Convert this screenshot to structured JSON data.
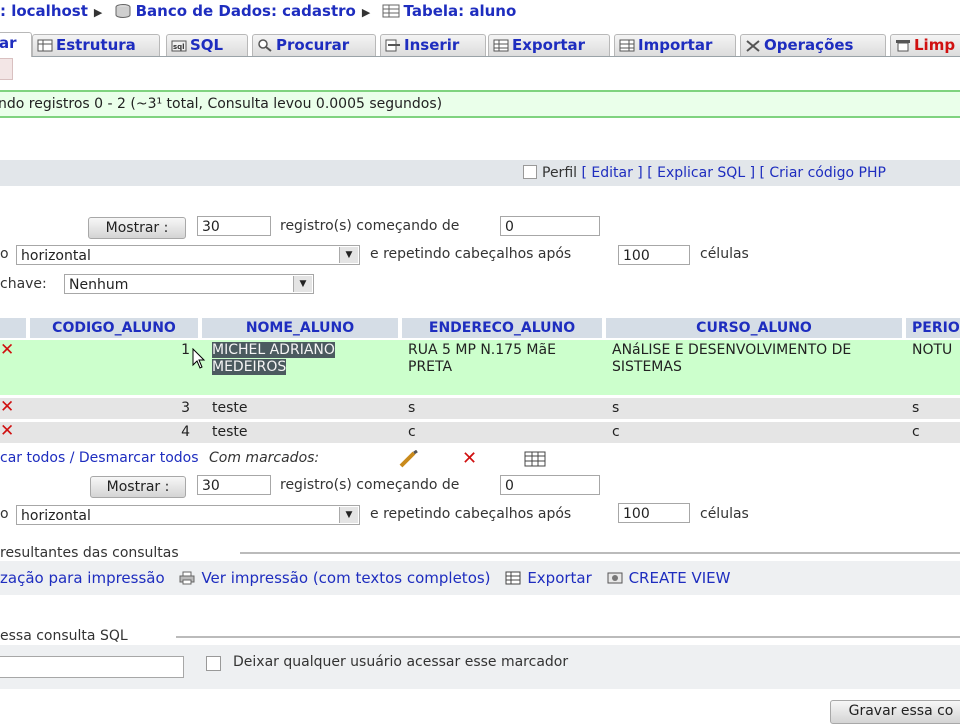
{
  "breadcrumb": {
    "server": ": localhost",
    "database": "Banco de Dados: cadastro",
    "table": "Tabela: aluno"
  },
  "tabs": [
    {
      "label": "ar",
      "icon": "browse-icon"
    },
    {
      "label": "Estrutura",
      "icon": "structure-icon"
    },
    {
      "label": "SQL",
      "icon": "sql-icon"
    },
    {
      "label": "Procurar",
      "icon": "search-icon"
    },
    {
      "label": "Inserir",
      "icon": "insert-icon"
    },
    {
      "label": "Exportar",
      "icon": "export-icon"
    },
    {
      "label": "Importar",
      "icon": "import-icon"
    },
    {
      "label": "Operações",
      "icon": "operations-icon"
    },
    {
      "label": "Limp",
      "icon": "empty-icon"
    }
  ],
  "notice": "ndo registros 0 - 2 (~3¹ total, Consulta levou 0.0005 segundos)",
  "profile_bar": {
    "profile": "Perfil",
    "edit": "[ Editar ]",
    "explain": "[ Explicar SQL ]",
    "php": "[ Criar código PHP"
  },
  "nav_top": {
    "show_button": "Mostrar :",
    "rows": "30",
    "start_label": "registro(s) começando de",
    "start": "0",
    "mode_prefix": "o",
    "mode": "horizontal",
    "repeat_label": "e repetindo cabeçalhos após",
    "repeat": "100",
    "cells_label": "células",
    "key_label": "chave:",
    "key_value": "Nenhum"
  },
  "table": {
    "columns": [
      "CODIGO_ALUNO",
      "NOME_ALUNO",
      "ENDERECO_ALUNO",
      "CURSO_ALUNO",
      "PERIO"
    ],
    "rows": [
      {
        "codigo": "1",
        "nome": "MICHEL ADRIANO MEDEIROS",
        "endereco": "RUA 5 MP N.175 MãE PRETA",
        "curso": "ANáLISE E DESENVOLVIMENTO DE SISTEMAS",
        "periodo": "NOTU"
      },
      {
        "codigo": "3",
        "nome": "teste",
        "endereco": "s",
        "curso": "s",
        "periodo": "s"
      },
      {
        "codigo": "4",
        "nome": "teste",
        "endereco": "c",
        "curso": "c",
        "periodo": "c"
      }
    ]
  },
  "mark": {
    "text": "car todos / Desmarcar todos",
    "with_marked": "Com marcados:"
  },
  "nav_bottom": {
    "show_button": "Mostrar :",
    "rows": "30",
    "start_label": "registro(s) começando de",
    "start": "0",
    "mode_prefix": "o",
    "mode": "horizontal",
    "repeat_label": "e repetindo cabeçalhos após",
    "repeat": "100",
    "cells_label": "células"
  },
  "results_ops": {
    "legend": "resultantes das consultas",
    "print": "zação para impressão",
    "print_full": "Ver impressão (com textos completos)",
    "export": "Exportar",
    "create_view": "CREATE VIEW"
  },
  "bookmark": {
    "legend": "essa consulta SQL",
    "allow_label": "Deixar qualquer usuário acessar esse marcador",
    "save_button": "Gravar essa co"
  },
  "colors": {
    "link": "#1e2dbf",
    "selected_row": "#ccffcc",
    "row": "#e5e5e5",
    "header": "#d5dde6",
    "delete": "#d01010"
  }
}
